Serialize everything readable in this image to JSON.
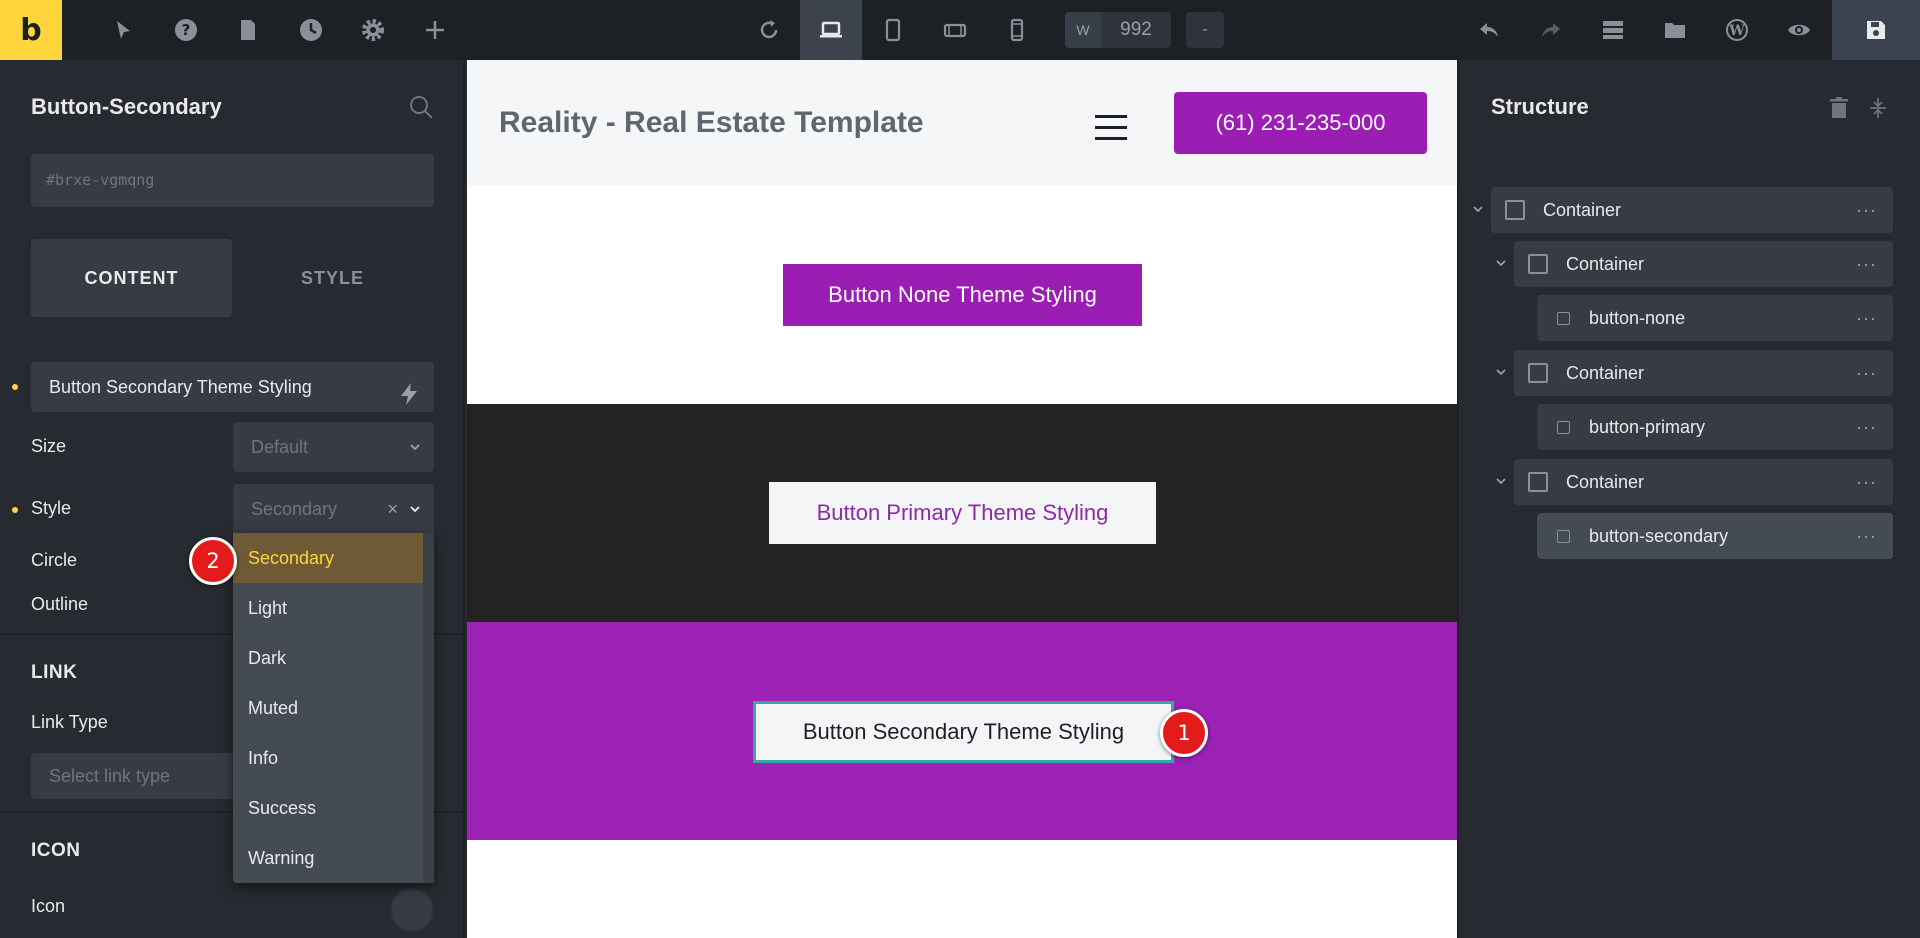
{
  "topbar": {
    "logo": "b",
    "width_label": "W",
    "width_value": "992",
    "width_minus": "-"
  },
  "element_panel": {
    "title": "Button-Secondary",
    "element_id_placeholder": "#brxe-vgmqng",
    "tabs": [
      "CONTENT",
      "STYLE"
    ],
    "text_value": "Button Secondary Theme Styling",
    "size_label": "Size",
    "size_value": "Default",
    "style_label": "Style",
    "style_value": "Secondary",
    "style_clear": "×",
    "circle_label": "Circle",
    "outline_label": "Outline",
    "link_section": "LINK",
    "link_type_label": "Link Type",
    "link_type_placeholder": "Select link type",
    "icon_section": "ICON",
    "icon_label": "Icon",
    "style_options": [
      "Secondary",
      "Light",
      "Dark",
      "Muted",
      "Info",
      "Success",
      "Warning"
    ],
    "selected_option": "Secondary"
  },
  "canvas": {
    "site_title": "Reality - Real Estate Template",
    "phone": "(61) 231-235-000",
    "btn_none": "Button None Theme Styling",
    "btn_primary": "Button Primary Theme Styling",
    "btn_secondary": "Button Secondary Theme Styling"
  },
  "structure": {
    "title": "Structure",
    "nodes": [
      {
        "label": "Container"
      },
      {
        "label": "Container"
      },
      {
        "label": "button-none"
      },
      {
        "label": "Container"
      },
      {
        "label": "button-primary"
      },
      {
        "label": "Container"
      },
      {
        "label": "button-secondary"
      }
    ],
    "more": "···"
  },
  "annotations": [
    "1",
    "2"
  ],
  "colors": {
    "accent": "#ffd53e",
    "brand_purple": "#9b1db4",
    "dark_section": "#232323",
    "badge_red": "#e31b1b",
    "focus_outline": "#3aa7a4"
  }
}
